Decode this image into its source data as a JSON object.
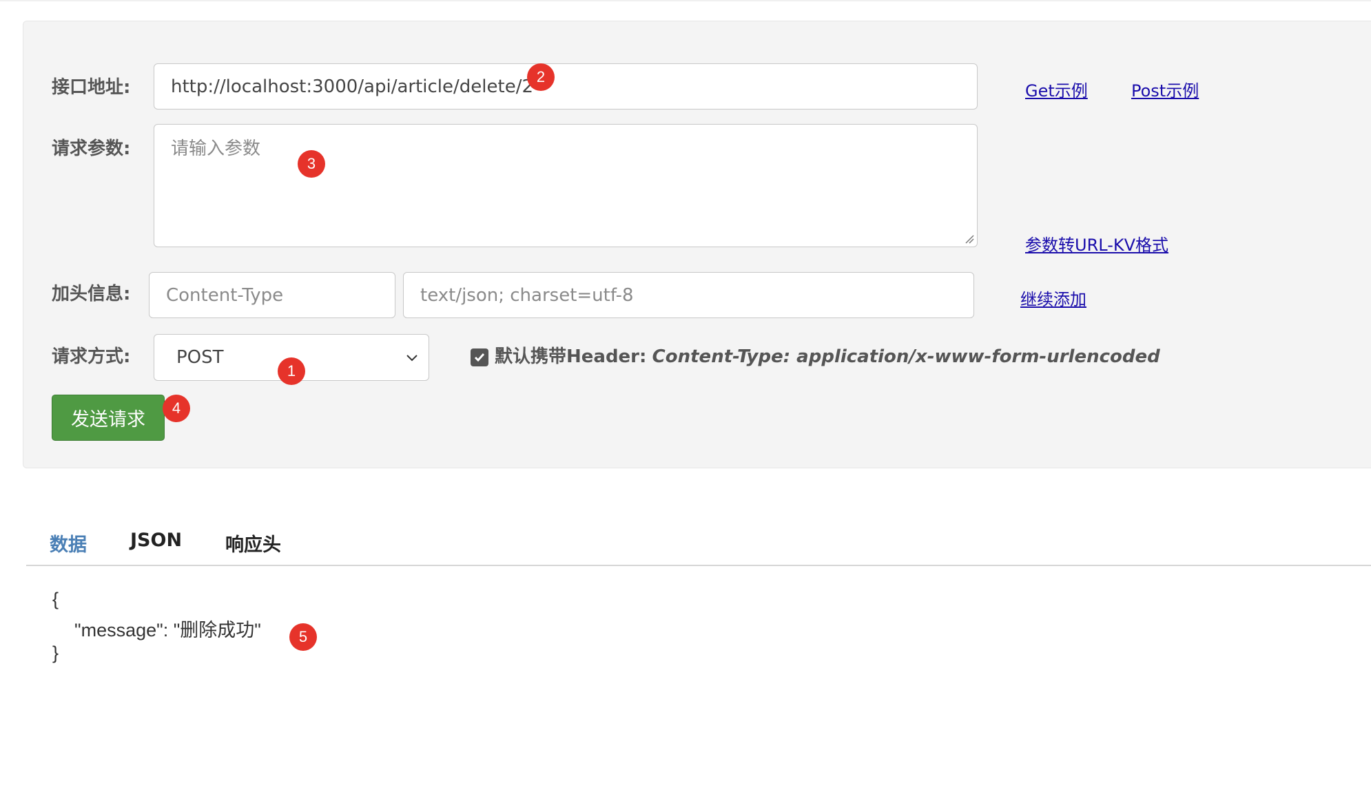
{
  "form": {
    "url_label": "接口地址:",
    "url_value": "http://localhost:3000/api/article/delete/2",
    "get_example": "Get示例",
    "post_example": "Post示例",
    "params_label": "请求参数:",
    "params_placeholder": "请输入参数",
    "params_to_kv": "参数转URL-KV格式",
    "headers_label": "加头信息:",
    "header_key_placeholder": "Content-Type",
    "header_value_placeholder": "text/json; charset=utf-8",
    "add_more": "继续添加",
    "method_label": "请求方式:",
    "method_selected": "POST",
    "default_header_checked": true,
    "default_header_label": "默认携带Header:",
    "default_header_value": "Content-Type: application/x-www-form-urlencoded",
    "send_button": "发送请求"
  },
  "badges": {
    "method": "1",
    "url": "2",
    "params": "3",
    "send": "4",
    "response": "5"
  },
  "tabs": [
    {
      "label": "数据",
      "active": true
    },
    {
      "label": "JSON",
      "active": false
    },
    {
      "label": "响应头",
      "active": false
    }
  ],
  "response": {
    "open_brace": "{",
    "message_line": "\"message\": \"删除成功\"",
    "close_brace": "}"
  },
  "colors": {
    "accent_tab": "#4a7fb5",
    "send_button": "#4f9a43",
    "badge": "#e6332a",
    "link": "#1a0dab"
  }
}
